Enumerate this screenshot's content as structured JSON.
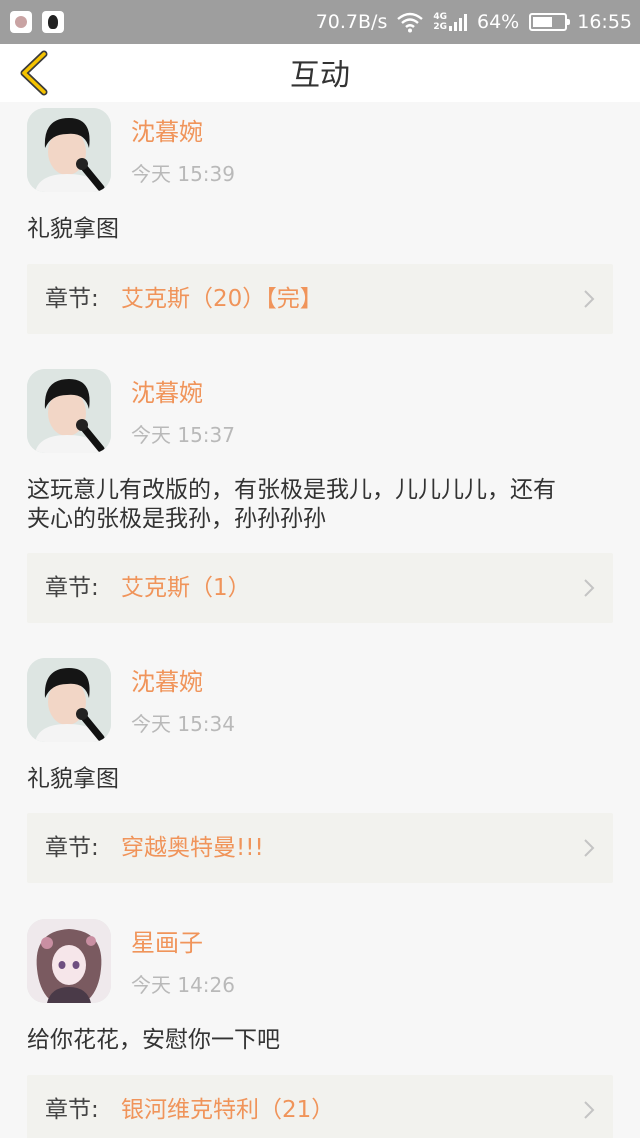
{
  "status_bar": {
    "net_speed": "70.7B/s",
    "net_4g": "4G",
    "net_2g": "2G",
    "battery": "64%",
    "battery_level": 0.64,
    "time": "16:55"
  },
  "header": {
    "title": "互动",
    "back_icon": "chevron-left-icon",
    "accent_color": "#f5c300"
  },
  "items": [
    {
      "username": "沈暮婉",
      "time": "今天 15:39",
      "comment": "礼貌拿图",
      "chapter_label": "章节:",
      "chapter_title": "艾克斯（20）【完】"
    },
    {
      "username": "沈暮婉",
      "time": "今天 15:37",
      "comment_line1": "这玩意儿有改版的，有张极是我儿，儿儿儿儿，还有",
      "comment_line2": "夹心的张极是我孙，孙孙孙孙",
      "chapter_label": "章节:",
      "chapter_title": "艾克斯（1）"
    },
    {
      "username": "沈暮婉",
      "time": "今天 15:34",
      "comment": "礼貌拿图",
      "chapter_label": "章节:",
      "chapter_title": "穿越奥特曼!!!"
    },
    {
      "username": "星画子",
      "time": "今天 14:26",
      "comment": "给你花花，安慰你一下吧",
      "chapter_label": "章节:",
      "chapter_title": "银河维克特利（21）"
    }
  ],
  "colors": {
    "username": "#f0945a",
    "chapter_title": "#f0945a",
    "card_bg": "#f2f2ee"
  }
}
